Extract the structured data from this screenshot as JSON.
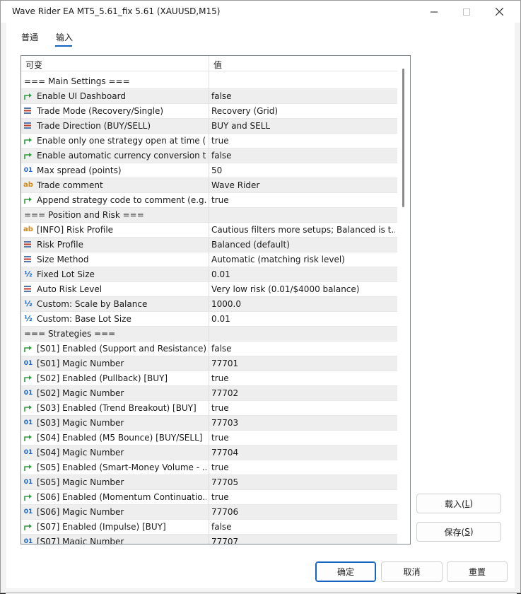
{
  "window": {
    "title": "Wave Rider EA MT5_5.61_fix 5.61 (XAUUSD,M15)"
  },
  "tabs": [
    {
      "label": "普通"
    },
    {
      "label": "输入"
    }
  ],
  "grid": {
    "col_variable": "可变",
    "col_value": "值",
    "rows": [
      {
        "type": "section",
        "name": "=== Main Settings ===",
        "value": ""
      },
      {
        "type": "bool",
        "name": "Enable UI Dashboard",
        "value": "false"
      },
      {
        "type": "enum",
        "name": "Trade Mode (Recovery/Single)",
        "value": "Recovery (Grid)"
      },
      {
        "type": "enum",
        "name": "Trade Direction (BUY/SELL)",
        "value": "BUY and SELL"
      },
      {
        "type": "bool",
        "name": "Enable only one strategy open at time (...",
        "value": "true"
      },
      {
        "type": "bool",
        "name": "Enable automatic currency conversion t...",
        "value": "false"
      },
      {
        "type": "int",
        "name": "Max spread (points)",
        "value": "50"
      },
      {
        "type": "string",
        "name": "Trade comment",
        "value": "Wave Rider"
      },
      {
        "type": "bool",
        "name": "Append strategy code to comment (e.g....",
        "value": "true"
      },
      {
        "type": "section",
        "name": "=== Position and Risk ===",
        "value": ""
      },
      {
        "type": "string",
        "name": "[INFO] Risk Profile",
        "value": "Cautious filters more setups; Balanced is t..."
      },
      {
        "type": "enum",
        "name": "Risk Profile",
        "value": "Balanced (default)"
      },
      {
        "type": "enum",
        "name": "Size Method",
        "value": "Automatic (matching risk level)"
      },
      {
        "type": "double",
        "name": "Fixed Lot Size",
        "value": "0.01"
      },
      {
        "type": "enum",
        "name": "Auto Risk Level",
        "value": "Very low risk (0.01/$4000 balance)"
      },
      {
        "type": "double",
        "name": "Custom: Scale by Balance",
        "value": "1000.0"
      },
      {
        "type": "double",
        "name": "Custom: Base Lot Size",
        "value": "0.01"
      },
      {
        "type": "section",
        "name": "=== Strategies ===",
        "value": ""
      },
      {
        "type": "bool",
        "name": "[S01] Enabled (Support and Resistance)...",
        "value": "false"
      },
      {
        "type": "int",
        "name": "[S01] Magic Number",
        "value": "77701"
      },
      {
        "type": "bool",
        "name": "[S02] Enabled (Pullback) [BUY]",
        "value": "true"
      },
      {
        "type": "int",
        "name": "[S02] Magic Number",
        "value": "77702"
      },
      {
        "type": "bool",
        "name": "[S03] Enabled (Trend Breakout) [BUY]",
        "value": "true"
      },
      {
        "type": "int",
        "name": "[S03] Magic Number",
        "value": "77703"
      },
      {
        "type": "bool",
        "name": "[S04] Enabled (M5 Bounce) [BUY/SELL]",
        "value": "true"
      },
      {
        "type": "int",
        "name": "[S04] Magic Number",
        "value": "77704"
      },
      {
        "type": "bool",
        "name": "[S05] Enabled (Smart-Money Volume - ...",
        "value": "true"
      },
      {
        "type": "int",
        "name": "[S05] Magic Number",
        "value": "77705"
      },
      {
        "type": "bool",
        "name": "[S06] Enabled (Momentum Continuatio...",
        "value": "true"
      },
      {
        "type": "int",
        "name": "[S06] Magic Number",
        "value": "77706"
      },
      {
        "type": "bool",
        "name": "[S07] Enabled (Impulse) [BUY]",
        "value": "false"
      },
      {
        "type": "int",
        "name": "[S07] Magic Number",
        "value": "77707"
      }
    ]
  },
  "icons": {
    "bool": "green-arrow-icon",
    "enum": "list-icon",
    "int": "01",
    "string": "ab",
    "double": "½"
  },
  "buttons": {
    "load_label": "载入(",
    "load_key": "L",
    "save_label": "保存(",
    "save_key": "S",
    "key_close": ")",
    "ok_label": "确定",
    "cancel_label": "取消",
    "reset_label": "重置"
  },
  "colors": {
    "accent": "#1565c0",
    "bool_icon": "#2e9e3e",
    "string_icon": "#d08a1a",
    "row_alt": "#eeeeee"
  }
}
